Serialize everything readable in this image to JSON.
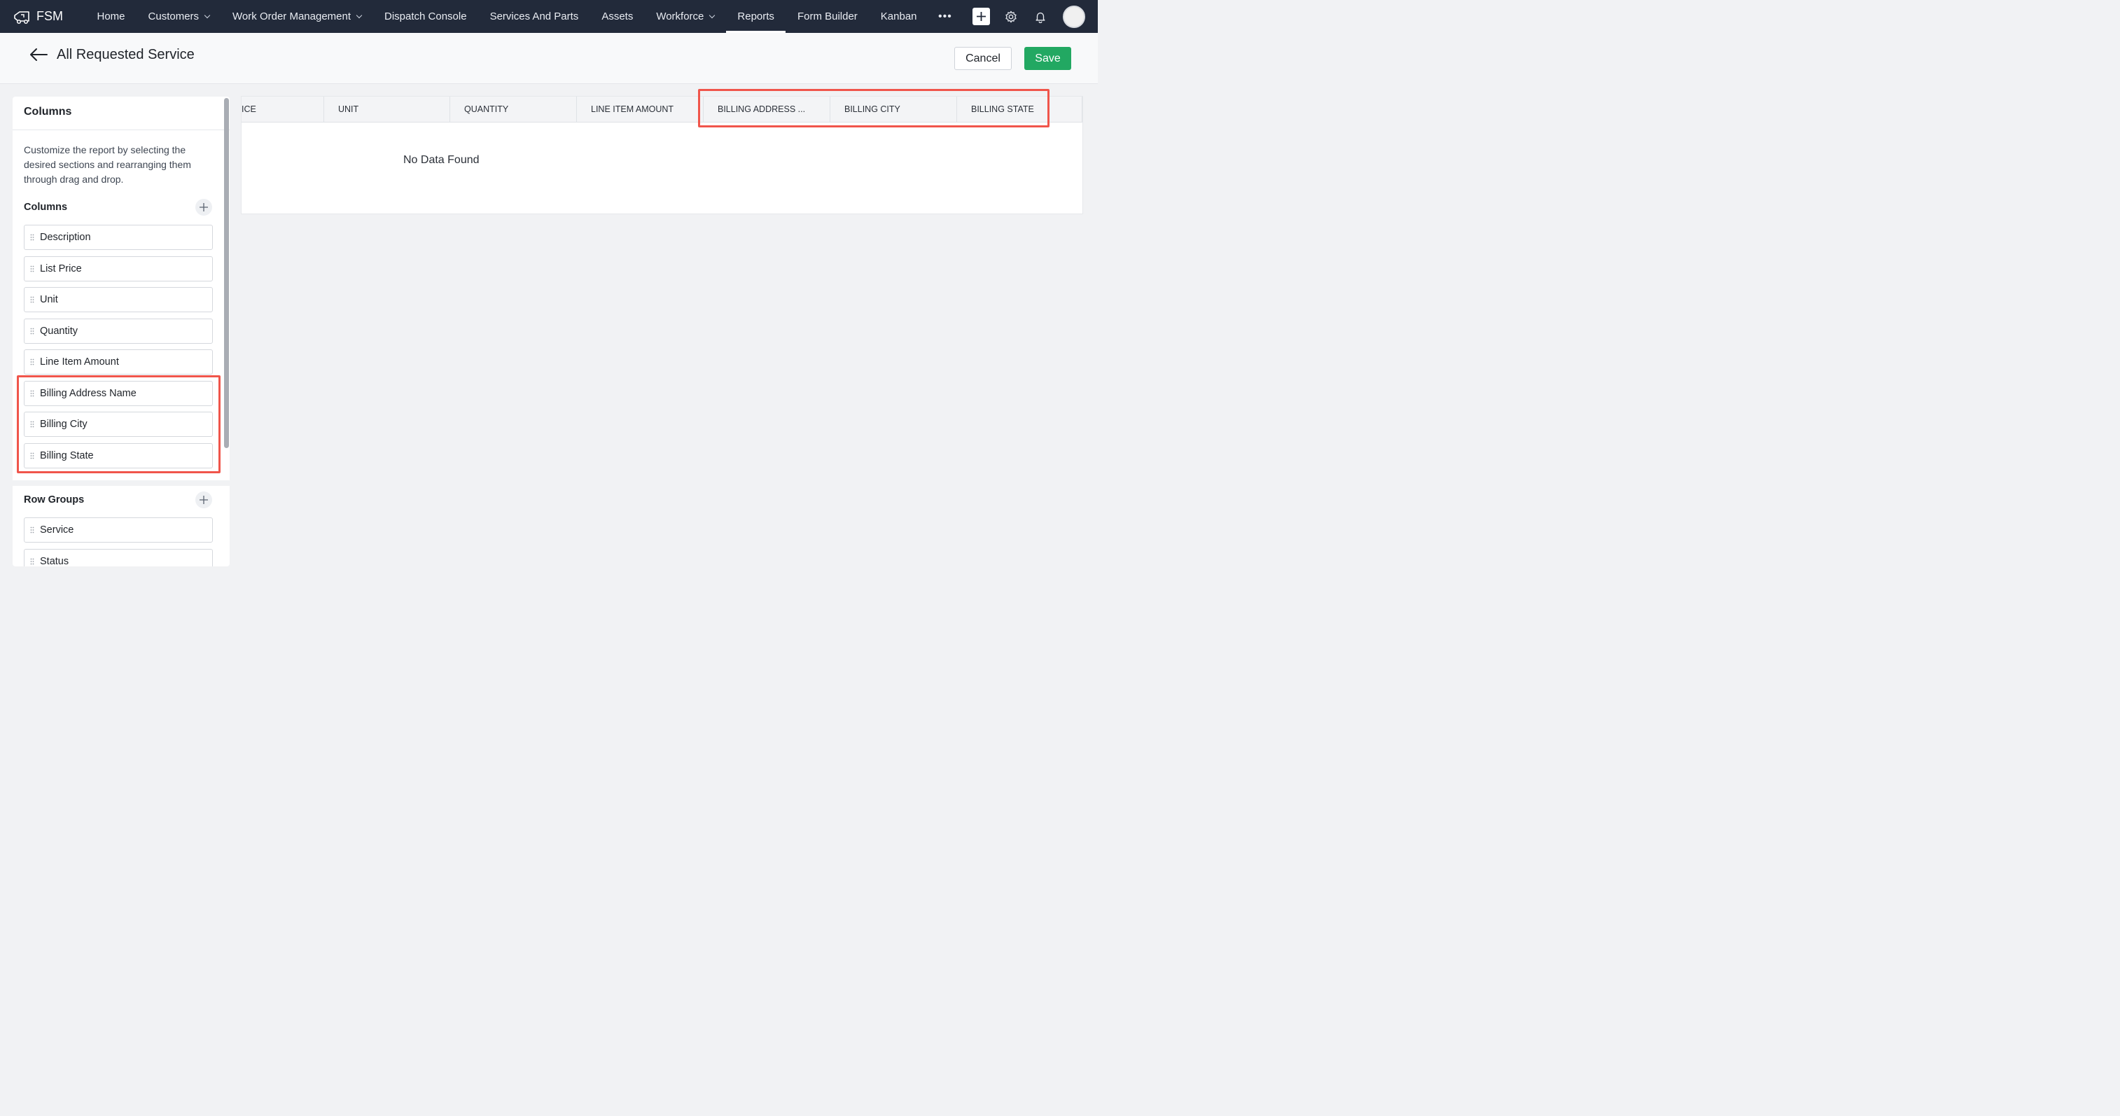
{
  "nav": {
    "brand": "FSM",
    "items": [
      {
        "label": "Home",
        "dropdown": false,
        "active": false
      },
      {
        "label": "Customers",
        "dropdown": true,
        "active": false
      },
      {
        "label": "Work Order Management",
        "dropdown": true,
        "active": false
      },
      {
        "label": "Dispatch Console",
        "dropdown": false,
        "active": false
      },
      {
        "label": "Services And Parts",
        "dropdown": false,
        "active": false
      },
      {
        "label": "Assets",
        "dropdown": false,
        "active": false
      },
      {
        "label": "Workforce",
        "dropdown": true,
        "active": false
      },
      {
        "label": "Reports",
        "dropdown": false,
        "active": true
      },
      {
        "label": "Form Builder",
        "dropdown": false,
        "active": false
      },
      {
        "label": "Kanban",
        "dropdown": false,
        "active": false
      }
    ],
    "more": "•••"
  },
  "header": {
    "title": "All Requested Service",
    "cancel_label": "Cancel",
    "save_label": "Save"
  },
  "sidebar": {
    "title": "Columns",
    "description": "Customize the report by selecting the desired sections and rearranging them through drag and drop.",
    "columns_label": "Columns",
    "columns": [
      "Description",
      "List Price",
      "Unit",
      "Quantity",
      "Line Item Amount",
      "Billing Address Name",
      "Billing City",
      "Billing State"
    ],
    "row_groups_label": "Row Groups",
    "row_groups": [
      "Service",
      "Status"
    ]
  },
  "table": {
    "headers": [
      "ICE",
      "UNIT",
      "QUANTITY",
      "LINE ITEM AMOUNT",
      "BILLING ADDRESS ...",
      "BILLING CITY",
      "BILLING STATE"
    ],
    "empty_text": "No Data Found"
  },
  "colors": {
    "nav_bg": "#222a3a",
    "save_green": "#22a862",
    "highlight_red": "#f0554b"
  }
}
